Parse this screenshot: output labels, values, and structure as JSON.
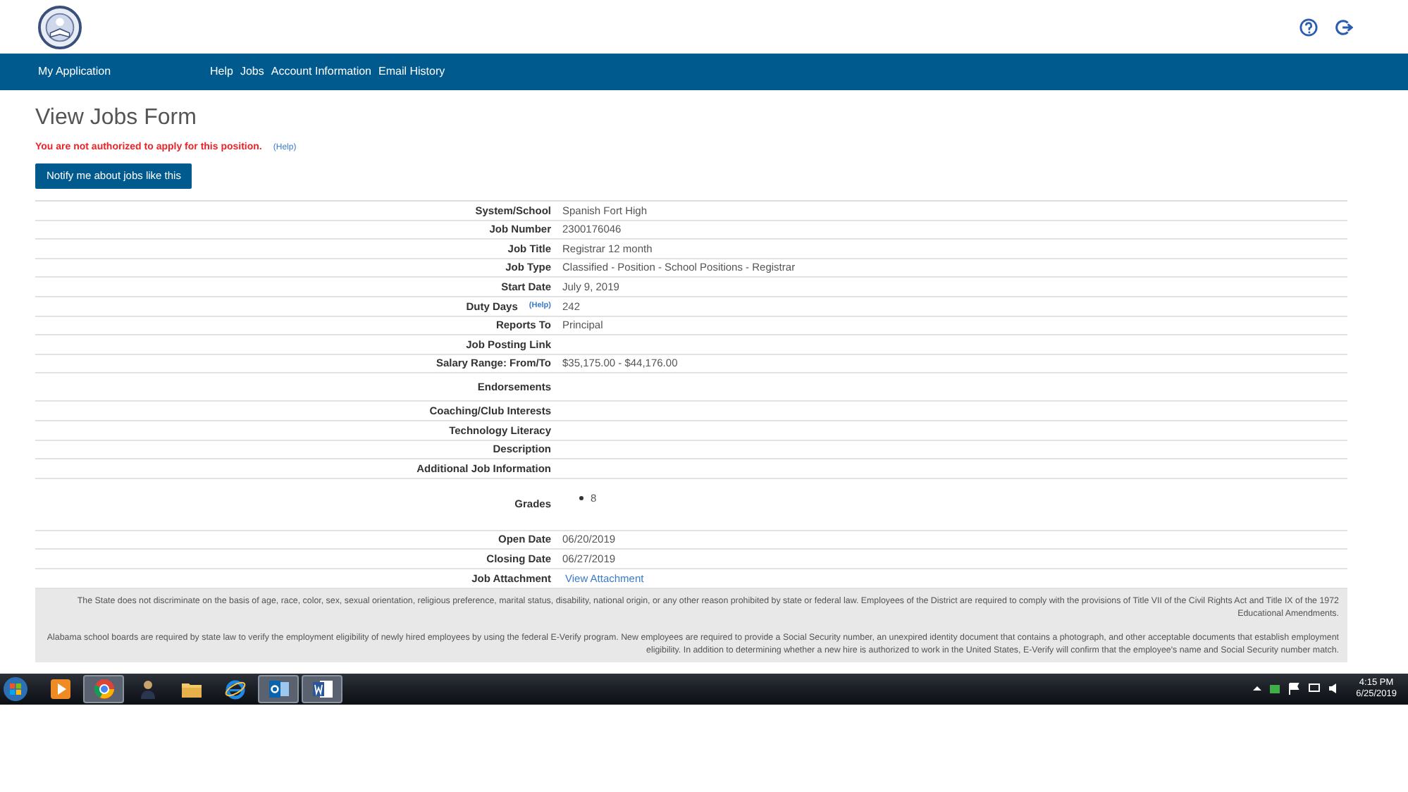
{
  "nav": {
    "brand": "My Application",
    "links": [
      "Help",
      "Jobs",
      "Account Information",
      "Email History"
    ]
  },
  "page": {
    "title": "View Jobs Form",
    "alert": "You are not authorized to apply for this position.",
    "alert_help": "(Help)",
    "notify_button": "Notify me about jobs like this"
  },
  "rows": [
    {
      "kind": "text",
      "label": "System/School",
      "value": "Spanish Fort High"
    },
    {
      "kind": "text",
      "label": "Job Number",
      "value": "2300176046"
    },
    {
      "kind": "text",
      "label": "Job Title",
      "value": "Registrar 12 month"
    },
    {
      "kind": "text",
      "label": "Job Type",
      "value": "Classified - Position - School Positions - Registrar"
    },
    {
      "kind": "text",
      "label": "Start Date",
      "value": "July 9, 2019"
    },
    {
      "kind": "text",
      "label": "Duty Days",
      "help": "(Help)",
      "value": "242"
    },
    {
      "kind": "text",
      "label": "Reports To",
      "value": "Principal"
    },
    {
      "kind": "text",
      "label": "Job Posting Link"
    },
    {
      "kind": "text",
      "label": "Salary Range: From/To",
      "value": "$35,175.00 - $44,176.00"
    },
    {
      "kind": "list",
      "label": "Endorsements"
    },
    {
      "kind": "text",
      "label": "Coaching/Club Interests"
    },
    {
      "kind": "text",
      "label": "Technology Literacy"
    },
    {
      "kind": "text",
      "label": "Description"
    },
    {
      "kind": "text",
      "label": "Additional Job Information"
    },
    {
      "kind": "list",
      "label": "Grades",
      "items": [
        "8"
      ]
    },
    {
      "kind": "text",
      "label": "Open Date",
      "value": "06/20/2019"
    },
    {
      "kind": "text",
      "label": "Closing Date",
      "value": "06/27/2019"
    },
    {
      "kind": "link",
      "label": "Job Attachment",
      "value": "View Attachment"
    }
  ],
  "notices": [
    "The State does not discriminate on the basis of age, race, color, sex, sexual orientation, religious preference, marital status, disability, national origin, or any other reason prohibited by state or federal law. Employees of the District are required to comply with the provisions of Title VII of the Civil Rights Act and Title IX of the 1972 Educational Amendments.",
    "Alabama school boards are required by state law to verify the employment eligibility of newly hired employees by using the federal E-Verify program. New employees are required to provide a Social Security number, an unexpired identity document that contains a photograph, and other acceptable documents that establish employment eligibility. In addition to determining whether a new hire is authorized to work in the United States, E-Verify will confirm that the employee's name and Social Security number match."
  ],
  "taskbar": {
    "apps": [
      {
        "kind": "media",
        "active": false
      },
      {
        "kind": "browser",
        "active": true
      },
      {
        "kind": "person",
        "active": false
      },
      {
        "kind": "folder",
        "active": false
      },
      {
        "kind": "ie",
        "active": false
      },
      {
        "kind": "mail",
        "active": true
      },
      {
        "kind": "word",
        "active": true
      }
    ],
    "time": "4:15 PM",
    "date": "6/25/2019"
  }
}
